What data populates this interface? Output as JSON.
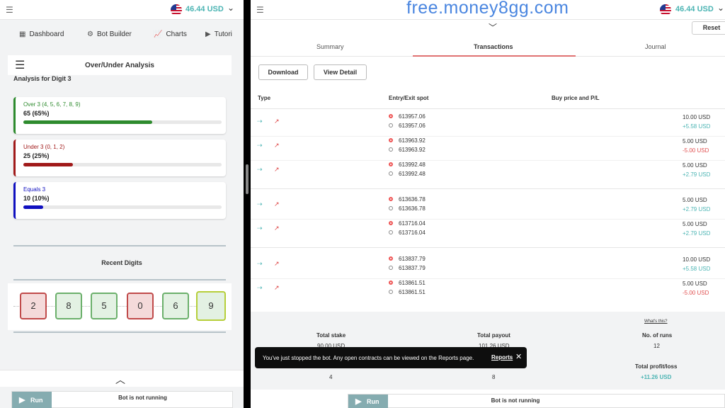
{
  "balance": "46.44 USD",
  "left": {
    "nav": [
      {
        "label": "Dashboard",
        "icon": "dashboard-icon"
      },
      {
        "label": "Bot Builder",
        "icon": "puzzle-icon"
      },
      {
        "label": "Charts",
        "icon": "chart-icon"
      },
      {
        "label": "Tutori",
        "icon": "play-icon"
      }
    ],
    "analysis_title": "Over/Under Analysis",
    "analysis_subtitle": "Analysis for Digit 3",
    "cards": [
      {
        "label": "Over 3 (4, 5, 6, 7, 8, 9)",
        "value": "65 (65%)",
        "fraction": 0.65,
        "color": "#2e8b2e"
      },
      {
        "label": "Under 3 (0, 1, 2)",
        "value": "25 (25%)",
        "fraction": 0.25,
        "color": "#a11a1a"
      },
      {
        "label": "Equals 3",
        "value": "10 (10%)",
        "fraction": 0.1,
        "color": "#1010c0"
      }
    ],
    "recent_title": "Recent Digits",
    "digits": [
      {
        "d": "2",
        "kind": "r"
      },
      {
        "d": "8",
        "kind": "g"
      },
      {
        "d": "5",
        "kind": "g"
      },
      {
        "d": "0",
        "kind": "r"
      },
      {
        "d": "6",
        "kind": "g"
      },
      {
        "d": "9",
        "kind": "g"
      }
    ],
    "run_label": "Run",
    "status": "Bot is not running"
  },
  "right": {
    "watermark": "free.money8gg.com",
    "reset": "Reset",
    "tabs": [
      "Summary",
      "Transactions",
      "Journal"
    ],
    "download": "Download",
    "view_detail": "View Detail",
    "headers": [
      "Type",
      "Entry/Exit spot",
      "Buy price and P/L"
    ],
    "rows": [
      {
        "entry": "613957.06",
        "exit": "613957.06",
        "price": "10.00 USD",
        "pl": "+5.58 USD",
        "pos": true
      },
      {
        "entry": "613963.92",
        "exit": "613963.92",
        "price": "5.00 USD",
        "pl": "-5.00 USD",
        "pos": false
      },
      {
        "entry": "613992.48",
        "exit": "613992.48",
        "price": "5.00 USD",
        "pl": "+2.79 USD",
        "pos": true
      },
      {
        "entry": "613636.78",
        "exit": "613636.78",
        "price": "5.00 USD",
        "pl": "+2.79 USD",
        "pos": true
      },
      {
        "entry": "613716.04",
        "exit": "613716.04",
        "price": "5.00 USD",
        "pl": "+2.79 USD",
        "pos": true
      },
      {
        "entry": "613837.79",
        "exit": "613837.79",
        "price": "10.00 USD",
        "pl": "+5.58 USD",
        "pos": true
      },
      {
        "entry": "613861.51",
        "exit": "613861.51",
        "price": "5.00 USD",
        "pl": "-5.00 USD",
        "pos": false
      }
    ],
    "whats_this": "What's this?",
    "summary": {
      "total_stake_label": "Total stake",
      "total_stake": "90.00 USD",
      "total_payout_label": "Total payout",
      "total_payout": "101.26 USD",
      "runs_label": "No. of runs",
      "runs": "12",
      "profit_label": "Total profit/loss",
      "profit": "+11.26 USD",
      "contracts_lost": "4",
      "contracts_won": "8"
    },
    "toast": {
      "message": "You've just stopped the bot. Any open contracts can be viewed on the Reports page.",
      "link": "Reports"
    },
    "run_label": "Run",
    "status": "Bot is not running"
  },
  "colors": {
    "accent": "#4bb4b3",
    "loss": "#e05050",
    "tab_underline": "#e07272"
  }
}
